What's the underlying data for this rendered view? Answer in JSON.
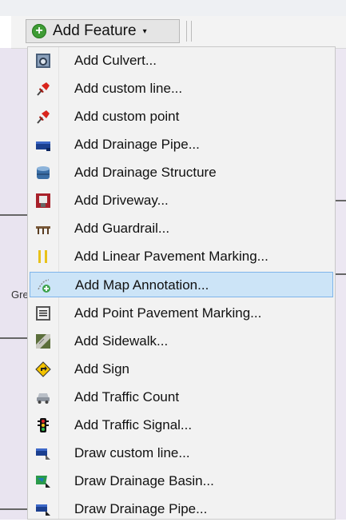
{
  "toolbar": {
    "add_feature_label": "Add Feature",
    "dropdown_arrow": "▾"
  },
  "background": {
    "partial_label": "Gre"
  },
  "menu": {
    "items": [
      {
        "label": "Add Culvert...",
        "icon": "culvert-icon"
      },
      {
        "label": "Add custom line...",
        "icon": "pushpin-icon"
      },
      {
        "label": "Add custom point",
        "icon": "pushpin-icon"
      },
      {
        "label": "Add Drainage Pipe...",
        "icon": "drainage-pipe-icon"
      },
      {
        "label": "Add Drainage Structure",
        "icon": "drainage-structure-icon"
      },
      {
        "label": "Add Driveway...",
        "icon": "driveway-icon"
      },
      {
        "label": "Add Guardrail...",
        "icon": "guardrail-icon"
      },
      {
        "label": "Add Linear Pavement Marking...",
        "icon": "linear-marking-icon"
      },
      {
        "label": "Add Map Annotation...",
        "icon": "map-annotation-icon"
      },
      {
        "label": "Add Point Pavement Marking...",
        "icon": "point-marking-icon"
      },
      {
        "label": "Add Sidewalk...",
        "icon": "sidewalk-icon"
      },
      {
        "label": "Add Sign",
        "icon": "sign-icon"
      },
      {
        "label": "Add Traffic Count",
        "icon": "car-icon"
      },
      {
        "label": "Add Traffic Signal...",
        "icon": "traffic-signal-icon"
      },
      {
        "label": "Draw custom line...",
        "icon": "draw-line-icon"
      },
      {
        "label": "Draw Drainage Basin...",
        "icon": "drainage-basin-icon"
      },
      {
        "label": "Draw Drainage Pipe...",
        "icon": "draw-pipe-icon"
      }
    ],
    "highlighted_index": 8
  }
}
